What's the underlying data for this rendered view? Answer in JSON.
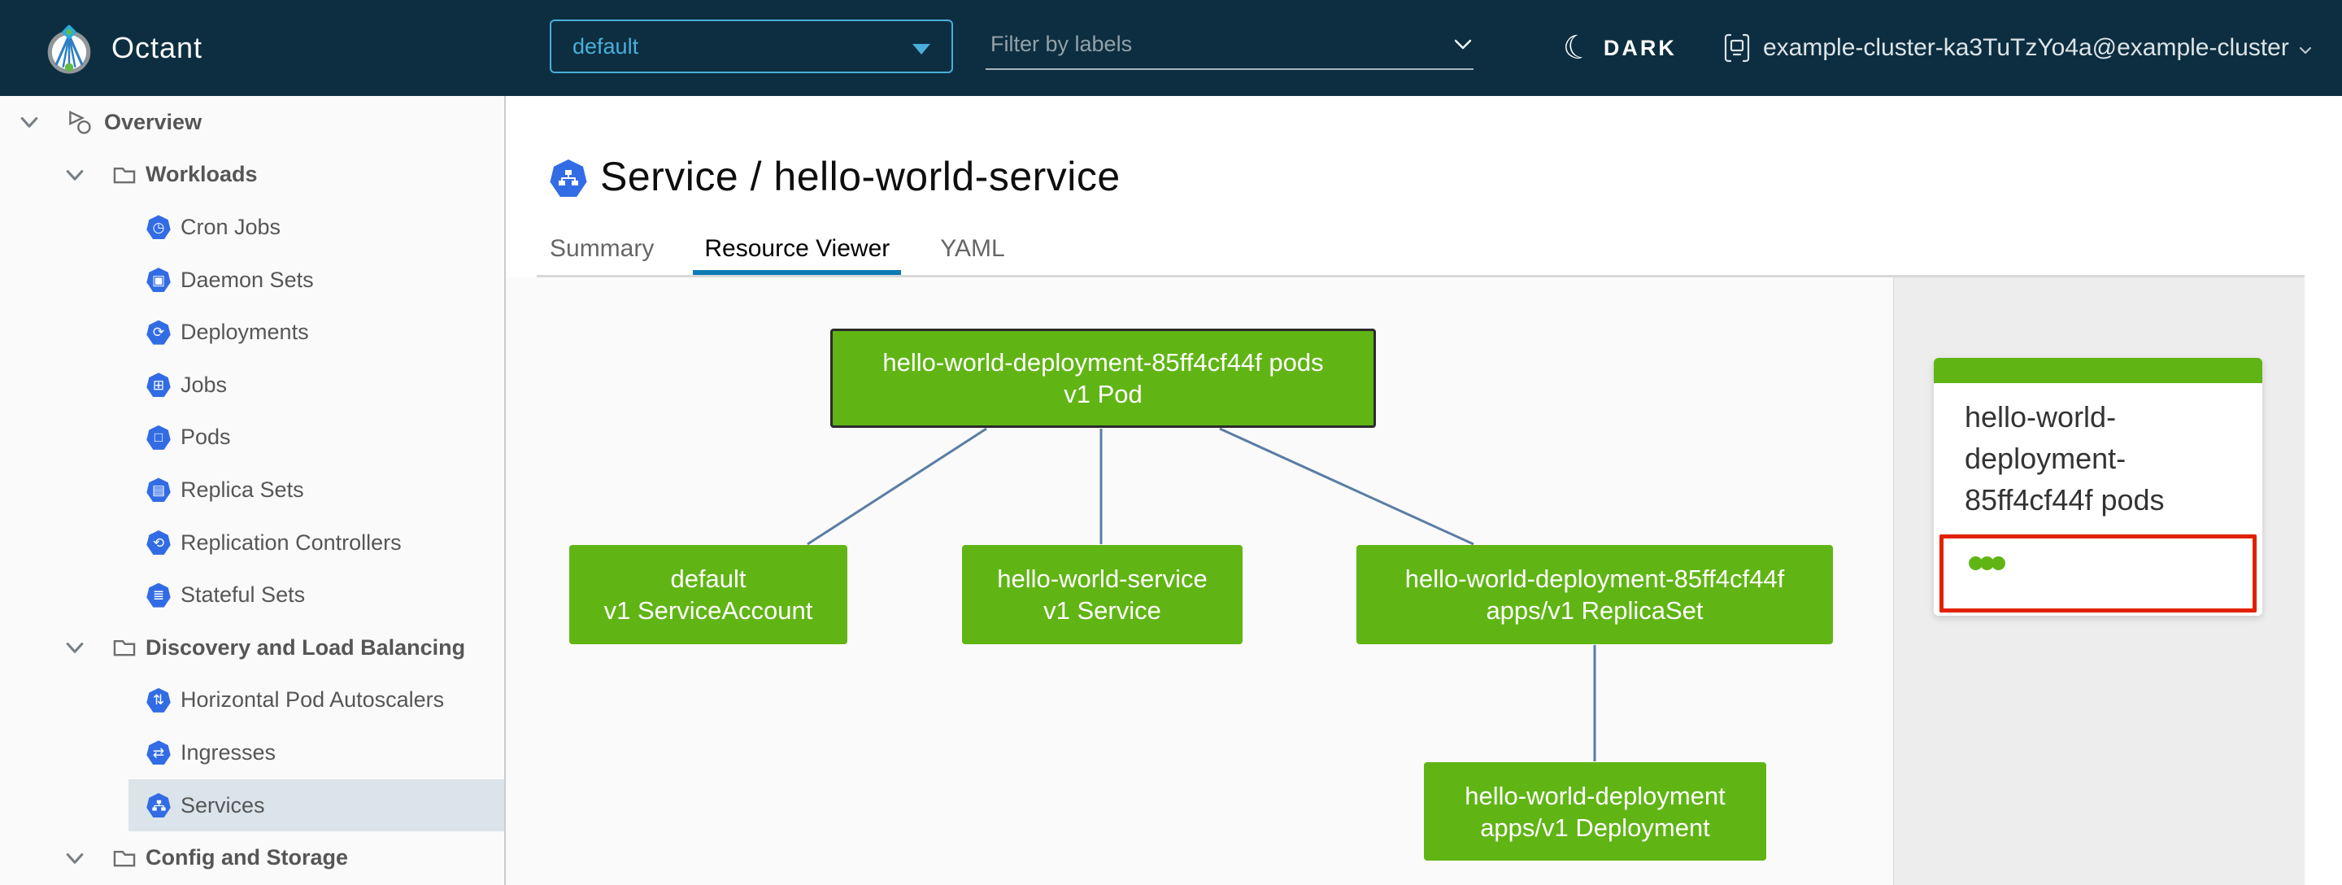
{
  "header": {
    "app_name": "Octant",
    "namespace_select": {
      "value": "default"
    },
    "filter": {
      "placeholder": "Filter by labels"
    },
    "theme_toggle": {
      "label": "DARK"
    },
    "context": {
      "label": "example-cluster-ka3TuTzYo4a@example-cluster"
    }
  },
  "sidebar": {
    "items": [
      {
        "label": "Overview",
        "level": 0,
        "icon": "overview-icon",
        "expanded": true
      },
      {
        "label": "Workloads",
        "level": 1,
        "icon": "folder-icon",
        "expanded": true
      },
      {
        "label": "Cron Jobs",
        "level": 2,
        "icon": "cron-jobs-icon"
      },
      {
        "label": "Daemon Sets",
        "level": 2,
        "icon": "daemon-sets-icon"
      },
      {
        "label": "Deployments",
        "level": 2,
        "icon": "deployments-icon"
      },
      {
        "label": "Jobs",
        "level": 2,
        "icon": "jobs-icon"
      },
      {
        "label": "Pods",
        "level": 2,
        "icon": "pods-icon"
      },
      {
        "label": "Replica Sets",
        "level": 2,
        "icon": "replica-sets-icon"
      },
      {
        "label": "Replication Controllers",
        "level": 2,
        "icon": "replication-controllers-icon"
      },
      {
        "label": "Stateful Sets",
        "level": 2,
        "icon": "stateful-sets-icon"
      },
      {
        "label": "Discovery and Load Balancing",
        "level": 1,
        "icon": "folder-icon",
        "expanded": true
      },
      {
        "label": "Horizontal Pod Autoscalers",
        "level": 2,
        "icon": "hpa-icon"
      },
      {
        "label": "Ingresses",
        "level": 2,
        "icon": "ingresses-icon"
      },
      {
        "label": "Services",
        "level": 2,
        "icon": "services-icon",
        "selected": true
      },
      {
        "label": "Config and Storage",
        "level": 1,
        "icon": "folder-icon",
        "expanded": true
      }
    ]
  },
  "main": {
    "title": "Service / hello-world-service",
    "tabs": [
      {
        "label": "Summary",
        "active": false
      },
      {
        "label": "Resource Viewer",
        "active": true
      },
      {
        "label": "YAML",
        "active": false
      }
    ]
  },
  "graph": {
    "nodes": [
      {
        "name": "hello-world-deployment-85ff4cf44f pods",
        "kind": "v1 Pod",
        "selected": true
      },
      {
        "name": "default",
        "kind": "v1 ServiceAccount",
        "selected": false
      },
      {
        "name": "hello-world-service",
        "kind": "v1 Service",
        "selected": false
      },
      {
        "name": "hello-world-deployment-85ff4cf44f",
        "kind": "apps/v1 ReplicaSet",
        "selected": false
      },
      {
        "name": "hello-world-deployment",
        "kind": "apps/v1 Deployment",
        "selected": false
      }
    ],
    "edges": [
      {
        "from": "pod",
        "to": "service-account"
      },
      {
        "from": "pod",
        "to": "service"
      },
      {
        "from": "pod",
        "to": "replica-set"
      },
      {
        "from": "replica-set",
        "to": "deployment"
      }
    ]
  },
  "side_panel": {
    "card": {
      "title": "hello-world-deployment-85ff4cf44f pods",
      "status_dots": 3
    }
  },
  "icons": {
    "cron-jobs": "◷",
    "daemon-sets": "▣",
    "deployments": "⟳",
    "jobs": "⊞",
    "pods": "□",
    "replica-sets": "▤",
    "replication-controllers": "⟲",
    "stateful-sets": "≣",
    "horizontal-pod-autoscalers": "⇅",
    "ingresses": "⇄",
    "moon": "☾"
  },
  "colors": {
    "header_bg": "#0c2e40",
    "k8s_blue": "#326ce5",
    "node_green": "#60b515",
    "node_selected_border": "#2b2b2b",
    "edge_blue": "#5b7da5",
    "selection_red": "#e12200",
    "select_blue": "#49afd9",
    "active_tab_underline": "#0c7bb3",
    "sidebar_selected_bg": "#dbe4ea"
  }
}
